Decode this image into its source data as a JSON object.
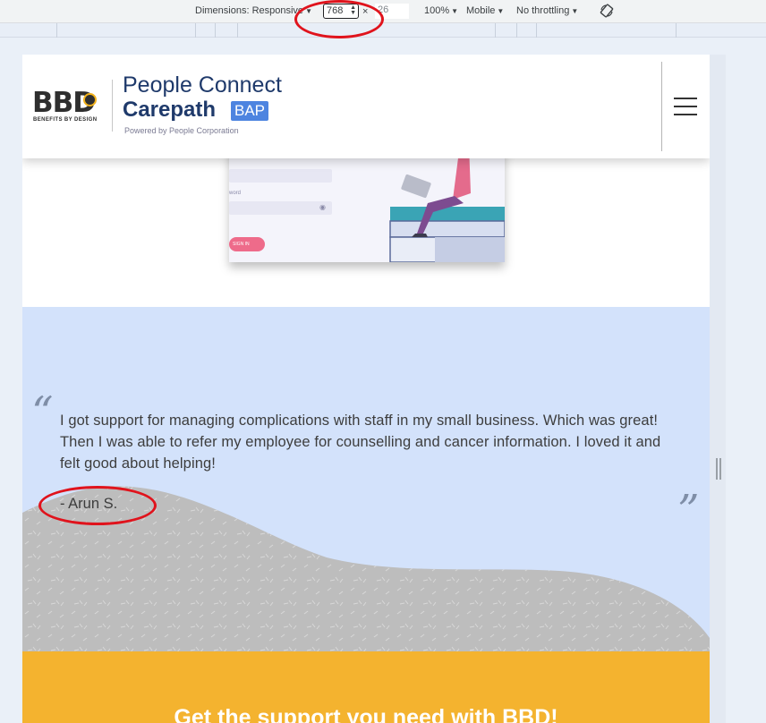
{
  "devtools": {
    "dimensions_label": "Dimensions: Responsive",
    "width_value": "768",
    "times": "×",
    "height_value": "26",
    "zoom": "100%",
    "device": "Mobile",
    "throttling": "No throttling"
  },
  "header": {
    "bbd_letters": "BBD",
    "bbd_tagline": "BENEFITS BY DESIGN",
    "brand_line1": "People Connect",
    "brand_line2": "Carepath",
    "brand_badge": "BAP",
    "powered_by": "Powered by People Corporation"
  },
  "illustration": {
    "password_label": "word",
    "signin_label": "SIGN IN"
  },
  "testimonial": {
    "open_quote": "“",
    "close_quote": "”",
    "text": "I got support for managing complications with staff in my small business. Which was great! Then I was able to refer my employee for counselling and cancer information. I loved it and felt good about helping!",
    "author": "- Arun S."
  },
  "cta": {
    "title": "Get the support you need with BBD!"
  },
  "colors": {
    "testimonial_bg": "#d3e2fb",
    "wave": "#bdbdbd",
    "cta_bg": "#f4b32f",
    "brand_navy": "#1f3a6b",
    "badge_blue": "#4d84e0",
    "annotation_red": "#e0131c"
  }
}
